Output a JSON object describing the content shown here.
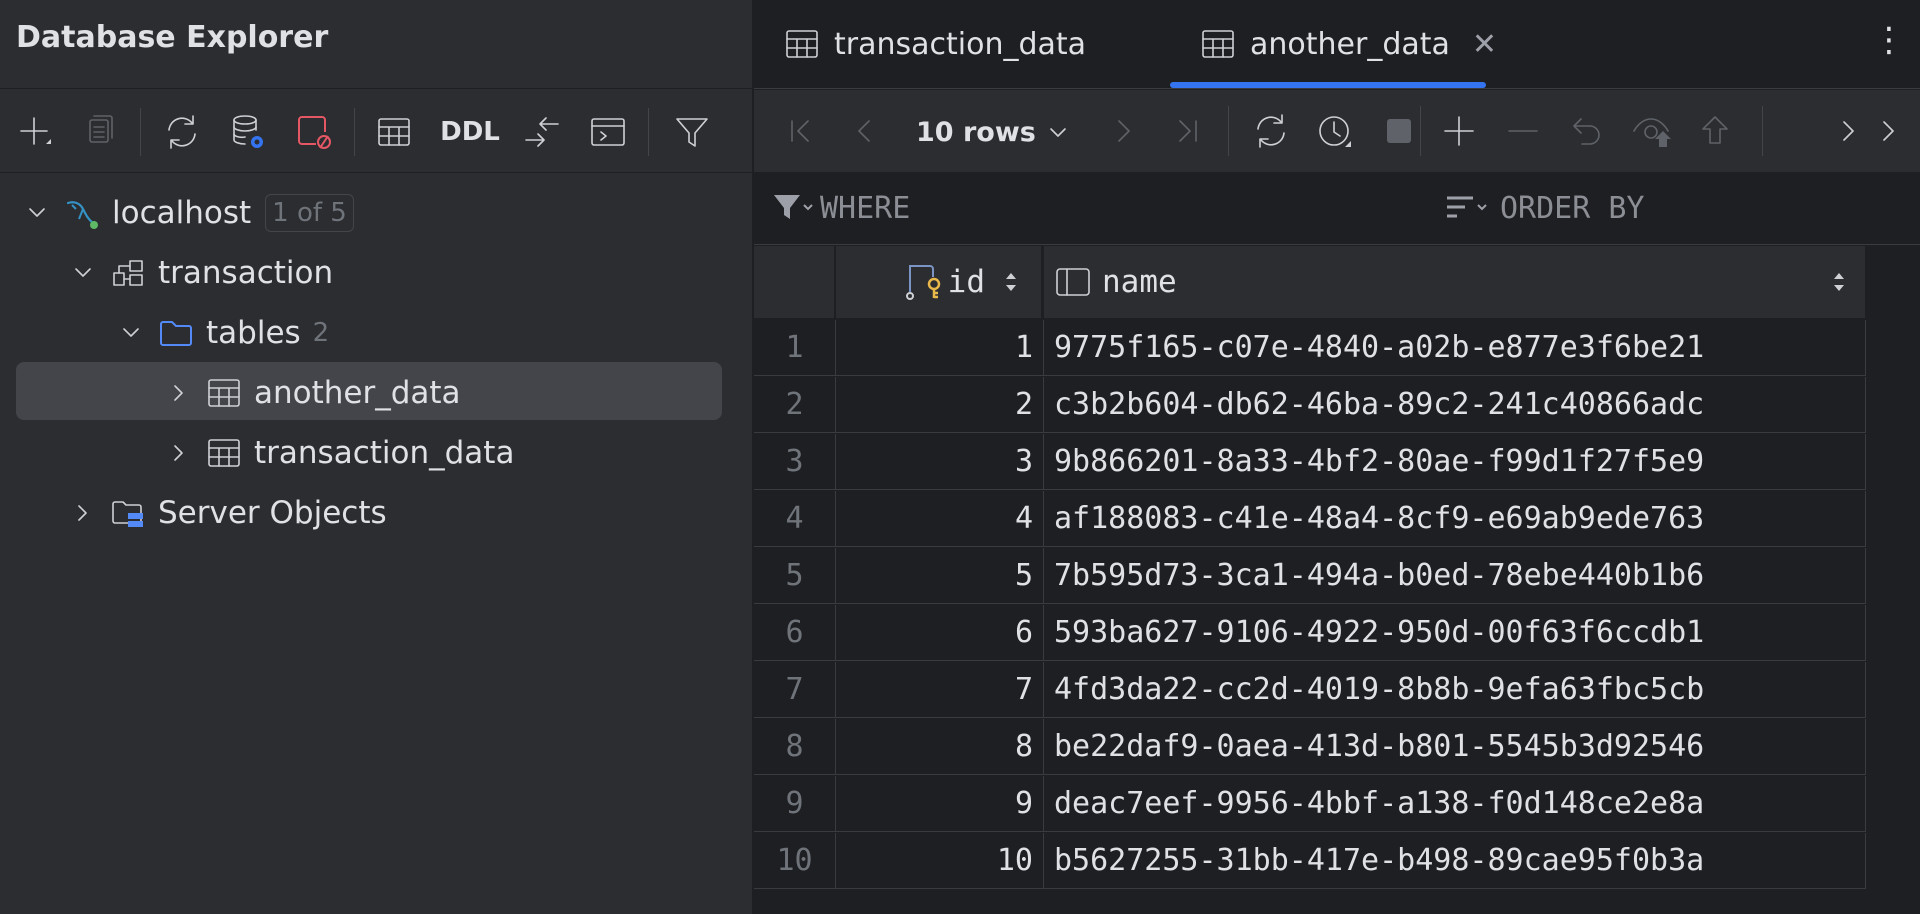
{
  "explorer": {
    "title": "Database Explorer",
    "toolbar": {
      "ddl_label": "DDL"
    }
  },
  "tree": {
    "host": {
      "label": "localhost",
      "badge": "1 of 5"
    },
    "schema": {
      "label": "transaction"
    },
    "tables_folder": {
      "label": "tables",
      "count": "2"
    },
    "tables": [
      {
        "label": "another_data",
        "selected": true
      },
      {
        "label": "transaction_data",
        "selected": false
      }
    ],
    "server_objects": {
      "label": "Server Objects"
    }
  },
  "tabs": [
    {
      "label": "transaction_data",
      "active": false
    },
    {
      "label": "another_data",
      "active": true
    }
  ],
  "grid_toolbar": {
    "rows_label": "10 rows"
  },
  "filter": {
    "where_label": "WHERE",
    "order_by_label": "ORDER BY"
  },
  "table": {
    "columns": [
      {
        "name": "id"
      },
      {
        "name": "name"
      }
    ],
    "rows": [
      {
        "rownum": "1",
        "id": "1",
        "name": "9775f165-c07e-4840-a02b-e877e3f6be21"
      },
      {
        "rownum": "2",
        "id": "2",
        "name": "c3b2b604-db62-46ba-89c2-241c40866adc"
      },
      {
        "rownum": "3",
        "id": "3",
        "name": "9b866201-8a33-4bf2-80ae-f99d1f27f5e9"
      },
      {
        "rownum": "4",
        "id": "4",
        "name": "af188083-c41e-48a4-8cf9-e69ab9ede763"
      },
      {
        "rownum": "5",
        "id": "5",
        "name": "7b595d73-3ca1-494a-b0ed-78ebe440b1b6"
      },
      {
        "rownum": "6",
        "id": "6",
        "name": "593ba627-9106-4922-950d-00f63f6ccdb1"
      },
      {
        "rownum": "7",
        "id": "7",
        "name": "4fd3da22-cc2d-4019-8b8b-9efa63fbc5cb"
      },
      {
        "rownum": "8",
        "id": "8",
        "name": "be22daf9-0aea-413d-b801-5545b3d92546"
      },
      {
        "rownum": "9",
        "id": "9",
        "name": "deac7eef-9956-4bbf-a138-f0d148ce2e8a"
      },
      {
        "rownum": "10",
        "id": "10",
        "name": "b5627255-31bb-417e-b498-89cae95f0b3a"
      }
    ]
  },
  "colors": {
    "accent": "#3574f0",
    "selection": "#43454a",
    "panel": "#2b2d30",
    "editor": "#1e1f22"
  }
}
